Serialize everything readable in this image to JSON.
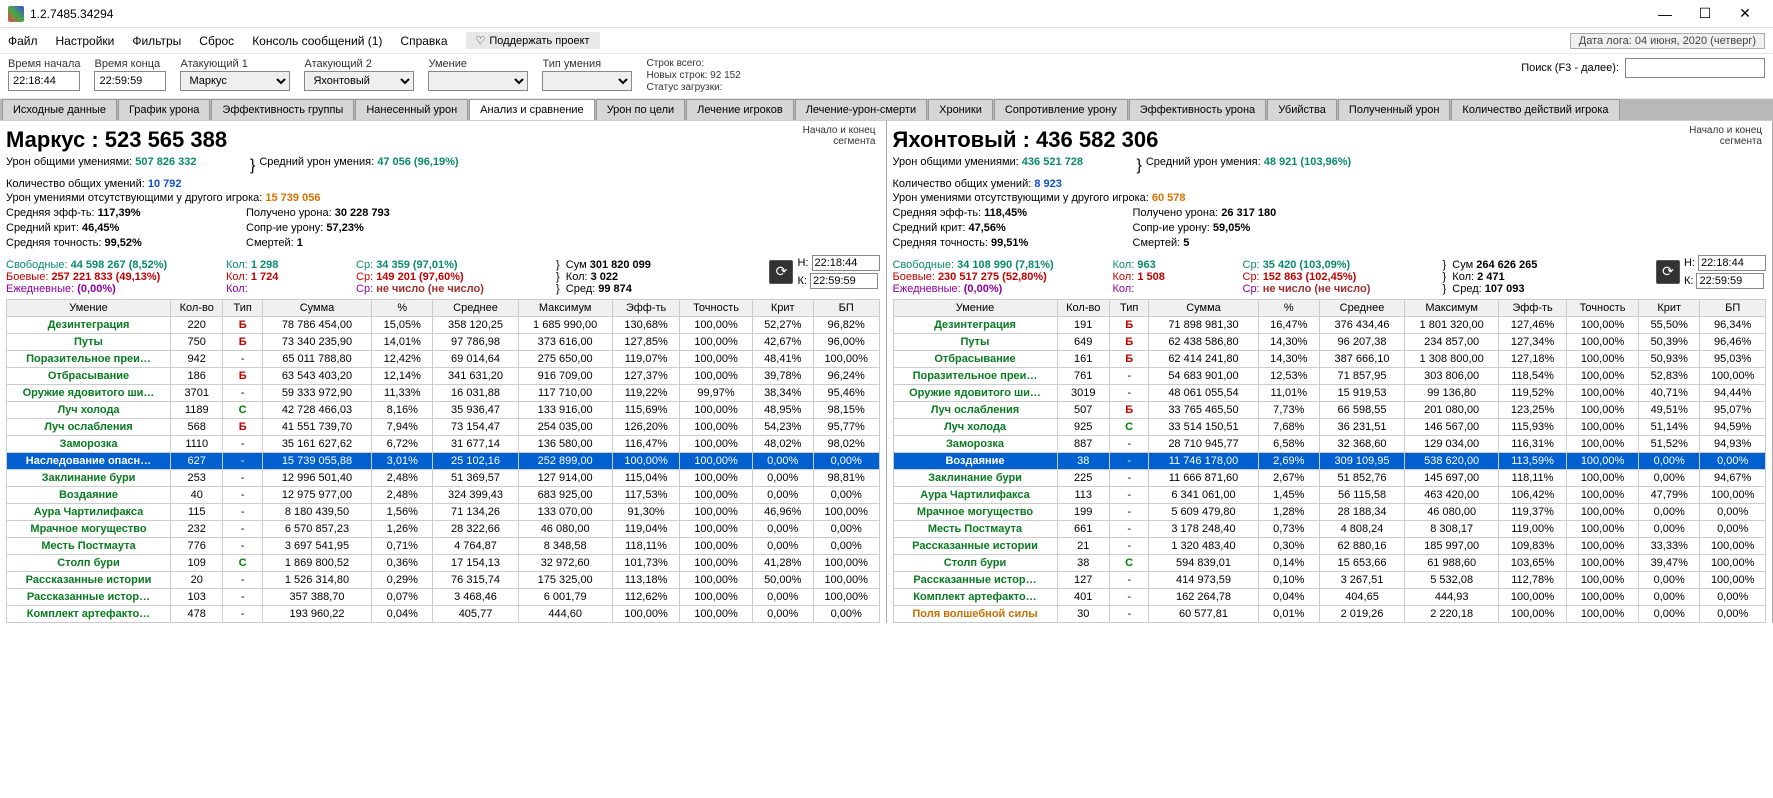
{
  "window": {
    "title": "1.2.7485.34294"
  },
  "menu": {
    "file": "Файл",
    "settings": "Настройки",
    "filters": "Фильтры",
    "reset": "Сброс",
    "console": "Консоль сообщений (1)",
    "help": "Справка",
    "support": "Поддержать проект"
  },
  "datelog": "Дата лога: 04 июня, 2020  (четверг)",
  "filters": {
    "start_label": "Время начала",
    "start": "22:18:44",
    "end_label": "Время конца",
    "end": "22:59:59",
    "att1_label": "Атакующий 1",
    "att1": "Маркус",
    "att2_label": "Атакующий 2",
    "att2": "Яхонтовый",
    "skill_label": "Умение",
    "skill": "",
    "type_label": "Тип умения",
    "type": "",
    "segtotal_l": "Строк всего:",
    "newrows_l": "Новых строк: 92 152",
    "status_l": "Статус загрузки:",
    "search_label": "Поиск (F3 - далее):"
  },
  "tabs": [
    "Исходные данные",
    "График урона",
    "Эффективность группы",
    "Нанесенный урон",
    "Анализ и сравнение",
    "Урон по цели",
    "Лечение игроков",
    "Лечение-урон-смерти",
    "Хроники",
    "Сопротивление урону",
    "Эффективность урона",
    "Убийства",
    "Полученный урон",
    "Количество действий игрока"
  ],
  "active_tab": 4,
  "segment_label": "Начало и конец\nсегмента",
  "seg_h_l": "Н:",
  "seg_k_l": "К:",
  "seg_h": "22:18:44",
  "seg_k": "22:59:59",
  "table_headers": [
    "Умение",
    "Кол-во",
    "Тип",
    "Сумма",
    "%",
    "Среднее",
    "Максимум",
    "Эфф-ть",
    "Точность",
    "Крит",
    "БП"
  ],
  "left": {
    "header": "Маркус : 523 565 388",
    "s1l": "Урон общими умениями:",
    "s1v": "507 826 332",
    "s2l": "Количество общих умений:",
    "s2v": "10 792",
    "s3l": "Урон умениями отсутствующими у другого игрока:",
    "s3v": "15 739 056",
    "s4l": "Средняя эфф-ть:",
    "s4v": "117,39%",
    "s5l": "Средний крит:",
    "s5v": "46,45%",
    "s6l": "Средняя точность:",
    "s6v": "99,52%",
    "avg_l": "Средний урон умения:",
    "avg_v": "47 056 (96,19%)",
    "recv_l": "Получено урона:",
    "recv_v": "30 228 793",
    "res_l": "Сопр-ие урону:",
    "res_v": "57,23%",
    "death_l": "Смертей:",
    "death_v": "1",
    "free_l": "Свободные:",
    "free_v": "44 598 267 (8,52%)",
    "comb_l": "Боевые:",
    "comb_v": "257 221 833 (49,13%)",
    "daily_l": "Ежедневные:",
    "daily_v": "(0,00%)",
    "cnt_l": "Кол:",
    "cnt1": "1 298",
    "cnt2": "1 724",
    "cnt3": "",
    "sr_l": "Ср:",
    "sr1": "34 359 (97,01%)",
    "sr2": "149 201 (97,60%)",
    "sr3": "не число (не число)",
    "sum_l": "Сум",
    "sum_v": "301 820 099",
    "cnt_t_l": "Кол:",
    "cnt_t": "3 022",
    "sred_l": "Сред:",
    "sred_v": "99 874",
    "rows": [
      [
        "Дезинтеграция",
        "220",
        "Б",
        "78 786 454,00",
        "15,05%",
        "358 120,25",
        "1 685 990,00",
        "130,68%",
        "100,00%",
        "52,27%",
        "96,82%"
      ],
      [
        "Путы",
        "750",
        "Б",
        "73 340 235,90",
        "14,01%",
        "97 786,98",
        "373 616,00",
        "127,85%",
        "100,00%",
        "42,67%",
        "96,00%"
      ],
      [
        "Поразительное преи…",
        "942",
        "-",
        "65 011 788,80",
        "12,42%",
        "69 014,64",
        "275 650,00",
        "119,07%",
        "100,00%",
        "48,41%",
        "100,00%"
      ],
      [
        "Отбрасывание",
        "186",
        "Б",
        "63 543 403,20",
        "12,14%",
        "341 631,20",
        "916 709,00",
        "127,37%",
        "100,00%",
        "39,78%",
        "96,24%"
      ],
      [
        "Оружие ядовитого ши…",
        "3701",
        "-",
        "59 333 972,90",
        "11,33%",
        "16 031,88",
        "117 710,00",
        "119,22%",
        "99,97%",
        "38,34%",
        "95,46%"
      ],
      [
        "Луч холода",
        "1189",
        "С",
        "42 728 466,03",
        "8,16%",
        "35 936,47",
        "133 916,00",
        "115,69%",
        "100,00%",
        "48,95%",
        "98,15%"
      ],
      [
        "Луч ослабления",
        "568",
        "Б",
        "41 551 739,70",
        "7,94%",
        "73 154,47",
        "254 035,00",
        "126,20%",
        "100,00%",
        "54,23%",
        "95,77%"
      ],
      [
        "Заморозка",
        "1110",
        "-",
        "35 161 627,62",
        "6,72%",
        "31 677,14",
        "136 580,00",
        "116,47%",
        "100,00%",
        "48,02%",
        "98,02%"
      ],
      [
        "Наследование опасн…",
        "627",
        "-",
        "15 739 055,88",
        "3,01%",
        "25 102,16",
        "252 899,00",
        "100,00%",
        "100,00%",
        "0,00%",
        "0,00%"
      ],
      [
        "Заклинание бури",
        "253",
        "-",
        "12 996 501,40",
        "2,48%",
        "51 369,57",
        "127 914,00",
        "115,04%",
        "100,00%",
        "0,00%",
        "98,81%"
      ],
      [
        "Воздаяние",
        "40",
        "-",
        "12 975 977,00",
        "2,48%",
        "324 399,43",
        "683 925,00",
        "117,53%",
        "100,00%",
        "0,00%",
        "0,00%"
      ],
      [
        "Аура Чартилифакса",
        "115",
        "-",
        "8 180 439,50",
        "1,56%",
        "71 134,26",
        "133 070,00",
        "91,30%",
        "100,00%",
        "46,96%",
        "100,00%"
      ],
      [
        "Мрачное могущество",
        "232",
        "-",
        "6 570 857,23",
        "1,26%",
        "28 322,66",
        "46 080,00",
        "119,04%",
        "100,00%",
        "0,00%",
        "0,00%"
      ],
      [
        "Месть Постмаута",
        "776",
        "-",
        "3 697 541,95",
        "0,71%",
        "4 764,87",
        "8 348,58",
        "118,11%",
        "100,00%",
        "0,00%",
        "0,00%"
      ],
      [
        "Столп бури",
        "109",
        "С",
        "1 869 800,52",
        "0,36%",
        "17 154,13",
        "32 972,60",
        "101,73%",
        "100,00%",
        "41,28%",
        "100,00%"
      ],
      [
        "Рассказанные истории",
        "20",
        "-",
        "1 526 314,80",
        "0,29%",
        "76 315,74",
        "175 325,00",
        "113,18%",
        "100,00%",
        "50,00%",
        "100,00%"
      ],
      [
        "Рассказанные истор…",
        "103",
        "-",
        "357 388,70",
        "0,07%",
        "3 468,46",
        "6 001,79",
        "112,62%",
        "100,00%",
        "0,00%",
        "100,00%"
      ],
      [
        "Комплект артефакто…",
        "478",
        "-",
        "193 960,22",
        "0,04%",
        "405,77",
        "444,60",
        "100,00%",
        "100,00%",
        "0,00%",
        "0,00%"
      ]
    ],
    "selected": 8
  },
  "right": {
    "header": "Яхонтовый : 436 582 306",
    "s1l": "Урон общими умениями:",
    "s1v": "436 521 728",
    "s2l": "Количество общих умений:",
    "s2v": "8 923",
    "s3l": "Урон умениями отсутствующими у другого игрока:",
    "s3v": "60 578",
    "s4l": "Средняя эфф-ть:",
    "s4v": "118,45%",
    "s5l": "Средний крит:",
    "s5v": "47,56%",
    "s6l": "Средняя точность:",
    "s6v": "99,51%",
    "avg_l": "Средний урон умения:",
    "avg_v": "48 921 (103,96%)",
    "recv_l": "Получено урона:",
    "recv_v": "26 317 180",
    "res_l": "Сопр-ие урону:",
    "res_v": "59,05%",
    "death_l": "Смертей:",
    "death_v": "5",
    "free_l": "Свободные:",
    "free_v": "34 108 990 (7,81%)",
    "comb_l": "Боевые:",
    "comb_v": "230 517 275 (52,80%)",
    "daily_l": "Ежедневные:",
    "daily_v": "(0,00%)",
    "cnt_l": "Кол:",
    "cnt1": "963",
    "cnt2": "1 508",
    "cnt3": "",
    "sr_l": "Ср:",
    "sr1": "35 420 (103,09%)",
    "sr2": "152 863 (102,45%)",
    "sr3": "не число (не число)",
    "sum_l": "Сум",
    "sum_v": "264 626 265",
    "cnt_t_l": "Кол:",
    "cnt_t": "2 471",
    "sred_l": "Сред:",
    "sred_v": "107 093",
    "rows": [
      [
        "Дезинтеграция",
        "191",
        "Б",
        "71 898 981,30",
        "16,47%",
        "376 434,46",
        "1 801 320,00",
        "127,46%",
        "100,00%",
        "55,50%",
        "96,34%"
      ],
      [
        "Путы",
        "649",
        "Б",
        "62 438 586,80",
        "14,30%",
        "96 207,38",
        "234 857,00",
        "127,34%",
        "100,00%",
        "50,39%",
        "96,46%"
      ],
      [
        "Отбрасывание",
        "161",
        "Б",
        "62 414 241,80",
        "14,30%",
        "387 666,10",
        "1 308 800,00",
        "127,18%",
        "100,00%",
        "50,93%",
        "95,03%"
      ],
      [
        "Поразительное преи…",
        "761",
        "-",
        "54 683 901,00",
        "12,53%",
        "71 857,95",
        "303 806,00",
        "118,54%",
        "100,00%",
        "52,83%",
        "100,00%"
      ],
      [
        "Оружие ядовитого ши…",
        "3019",
        "-",
        "48 061 055,54",
        "11,01%",
        "15 919,53",
        "99 136,80",
        "119,52%",
        "100,00%",
        "40,71%",
        "94,44%"
      ],
      [
        "Луч ослабления",
        "507",
        "Б",
        "33 765 465,50",
        "7,73%",
        "66 598,55",
        "201 080,00",
        "123,25%",
        "100,00%",
        "49,51%",
        "95,07%"
      ],
      [
        "Луч холода",
        "925",
        "С",
        "33 514 150,51",
        "7,68%",
        "36 231,51",
        "146 567,00",
        "115,93%",
        "100,00%",
        "51,14%",
        "94,59%"
      ],
      [
        "Заморозка",
        "887",
        "-",
        "28 710 945,77",
        "6,58%",
        "32 368,60",
        "129 034,00",
        "116,31%",
        "100,00%",
        "51,52%",
        "94,93%"
      ],
      [
        "Воздаяние",
        "38",
        "-",
        "11 746 178,00",
        "2,69%",
        "309 109,95",
        "538 620,00",
        "113,59%",
        "100,00%",
        "0,00%",
        "0,00%"
      ],
      [
        "Заклинание бури",
        "225",
        "-",
        "11 666 871,60",
        "2,67%",
        "51 852,76",
        "145 697,00",
        "118,11%",
        "100,00%",
        "0,00%",
        "94,67%"
      ],
      [
        "Аура Чартилифакса",
        "113",
        "-",
        "6 341 061,00",
        "1,45%",
        "56 115,58",
        "463 420,00",
        "106,42%",
        "100,00%",
        "47,79%",
        "100,00%"
      ],
      [
        "Мрачное могущество",
        "199",
        "-",
        "5 609 479,80",
        "1,28%",
        "28 188,34",
        "46 080,00",
        "119,37%",
        "100,00%",
        "0,00%",
        "0,00%"
      ],
      [
        "Месть Постмаута",
        "661",
        "-",
        "3 178 248,40",
        "0,73%",
        "4 808,24",
        "8 308,17",
        "119,00%",
        "100,00%",
        "0,00%",
        "0,00%"
      ],
      [
        "Рассказанные истории",
        "21",
        "-",
        "1 320 483,40",
        "0,30%",
        "62 880,16",
        "185 997,00",
        "109,83%",
        "100,00%",
        "33,33%",
        "100,00%"
      ],
      [
        "Столп бури",
        "38",
        "С",
        "594 839,01",
        "0,14%",
        "15 653,66",
        "61 988,60",
        "103,65%",
        "100,00%",
        "39,47%",
        "100,00%"
      ],
      [
        "Рассказанные истор…",
        "127",
        "-",
        "414 973,59",
        "0,10%",
        "3 267,51",
        "5 532,08",
        "112,78%",
        "100,00%",
        "0,00%",
        "100,00%"
      ],
      [
        "Комплект артефакто…",
        "401",
        "-",
        "162 264,78",
        "0,04%",
        "404,65",
        "444,93",
        "100,00%",
        "100,00%",
        "0,00%",
        "0,00%"
      ],
      [
        "Поля волшебной силы",
        "30",
        "-",
        "60 577,81",
        "0,01%",
        "2 019,26",
        "2 220,18",
        "100,00%",
        "100,00%",
        "0,00%",
        "0,00%"
      ]
    ],
    "selected": 8,
    "last_row_color": "orange"
  }
}
